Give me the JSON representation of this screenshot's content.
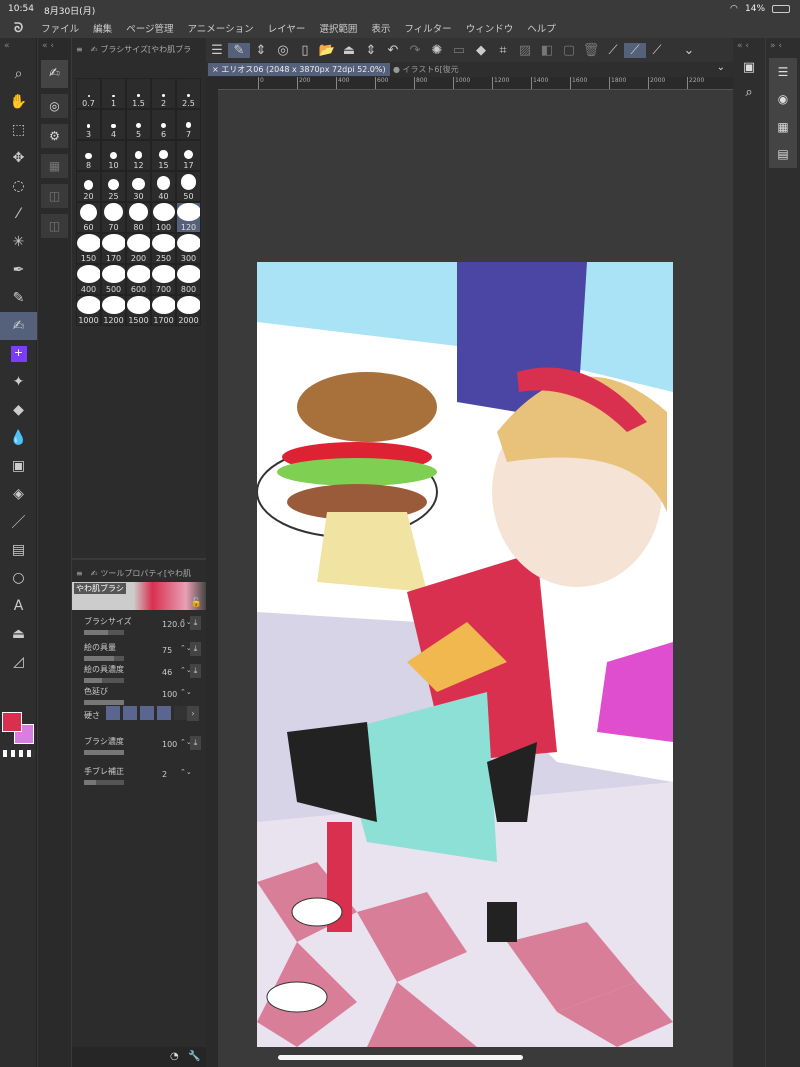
{
  "status": {
    "time": "10:54",
    "date": "8月30日(月)",
    "battery": "14%"
  },
  "menu": [
    "ファイル",
    "編集",
    "ページ管理",
    "アニメーション",
    "レイヤー",
    "選択範囲",
    "表示",
    "フィルター",
    "ウィンドウ",
    "ヘルプ"
  ],
  "brush_panel": {
    "title": "ブラシサイズ[やわ肌ブラ",
    "sizes": [
      "0.7",
      "1",
      "1.5",
      "2",
      "2.5",
      "3",
      "4",
      "5",
      "6",
      "7",
      "8",
      "10",
      "12",
      "15",
      "17",
      "20",
      "25",
      "30",
      "40",
      "50",
      "60",
      "70",
      "80",
      "100",
      "120",
      "150",
      "170",
      "200",
      "250",
      "300",
      "400",
      "500",
      "600",
      "700",
      "800",
      "1000",
      "1200",
      "1500",
      "1700",
      "2000"
    ],
    "selected": "120"
  },
  "tool_property": {
    "title": "ツールプロパティ[やわ肌",
    "brush_name": "やわ肌ブラシ",
    "props": [
      {
        "label": "ブラシサイズ",
        "value": "120.0",
        "level": 0.6
      },
      {
        "label": "絵の具量",
        "value": "75",
        "level": 0.75
      },
      {
        "label": "絵の具濃度",
        "value": "46",
        "level": 0.46
      },
      {
        "label": "色延び",
        "value": "100",
        "level": 1.0
      },
      {
        "label": "ブラシ濃度",
        "value": "100",
        "level": 1.0
      },
      {
        "label": "手ブレ補正",
        "value": "2",
        "level": 0.3
      }
    ],
    "hardness_label": "硬さ",
    "hardness_level": 4
  },
  "tabs": [
    {
      "label": "× エリオス06 (2048 x 3870px 72dpi 52.0%)",
      "active": true
    },
    {
      "label": "● イラスト6[復元",
      "active": false
    }
  ],
  "ruler": [
    "0",
    "200",
    "400",
    "600",
    "800",
    "1000",
    "1200",
    "1400",
    "1600",
    "1800",
    "2000",
    "2200"
  ],
  "colors": {
    "main": "#d9304f",
    "sub": "#d77fe0",
    "accent": "#55607a"
  }
}
